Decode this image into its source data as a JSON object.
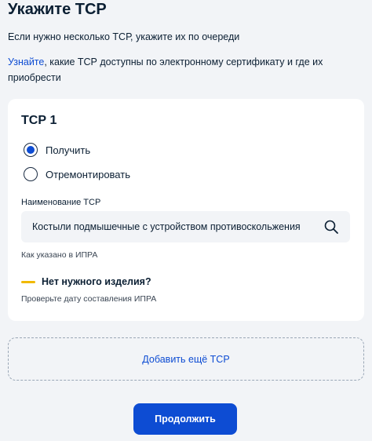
{
  "header": {
    "title": "Укажите ТСР",
    "subtitle": "Если нужно несколько ТСР, укажите их по очереди"
  },
  "info": {
    "link_text": "Узнайте",
    "text": ", какие ТСР доступны по электронному сертификату и где их приобрести"
  },
  "card": {
    "title": "ТСР 1",
    "radio_options": [
      {
        "label": "Получить",
        "checked": true
      },
      {
        "label": "Отремонтировать",
        "checked": false
      }
    ],
    "field_label": "Наименование ТСР",
    "field_value": "Костыли подмышечные с устройством противоскольжения",
    "field_hint": "Как указано в ИПРА",
    "warning_title": "Нет нужного изделия?",
    "warning_text": "Проверьте дату составления ИПРА"
  },
  "add_button_label": "Добавить ещё ТСР",
  "continue_button_label": "Продолжить",
  "colors": {
    "accent": "#0d4cd3",
    "warning": "#f1b900",
    "background": "#f2f4f7"
  }
}
